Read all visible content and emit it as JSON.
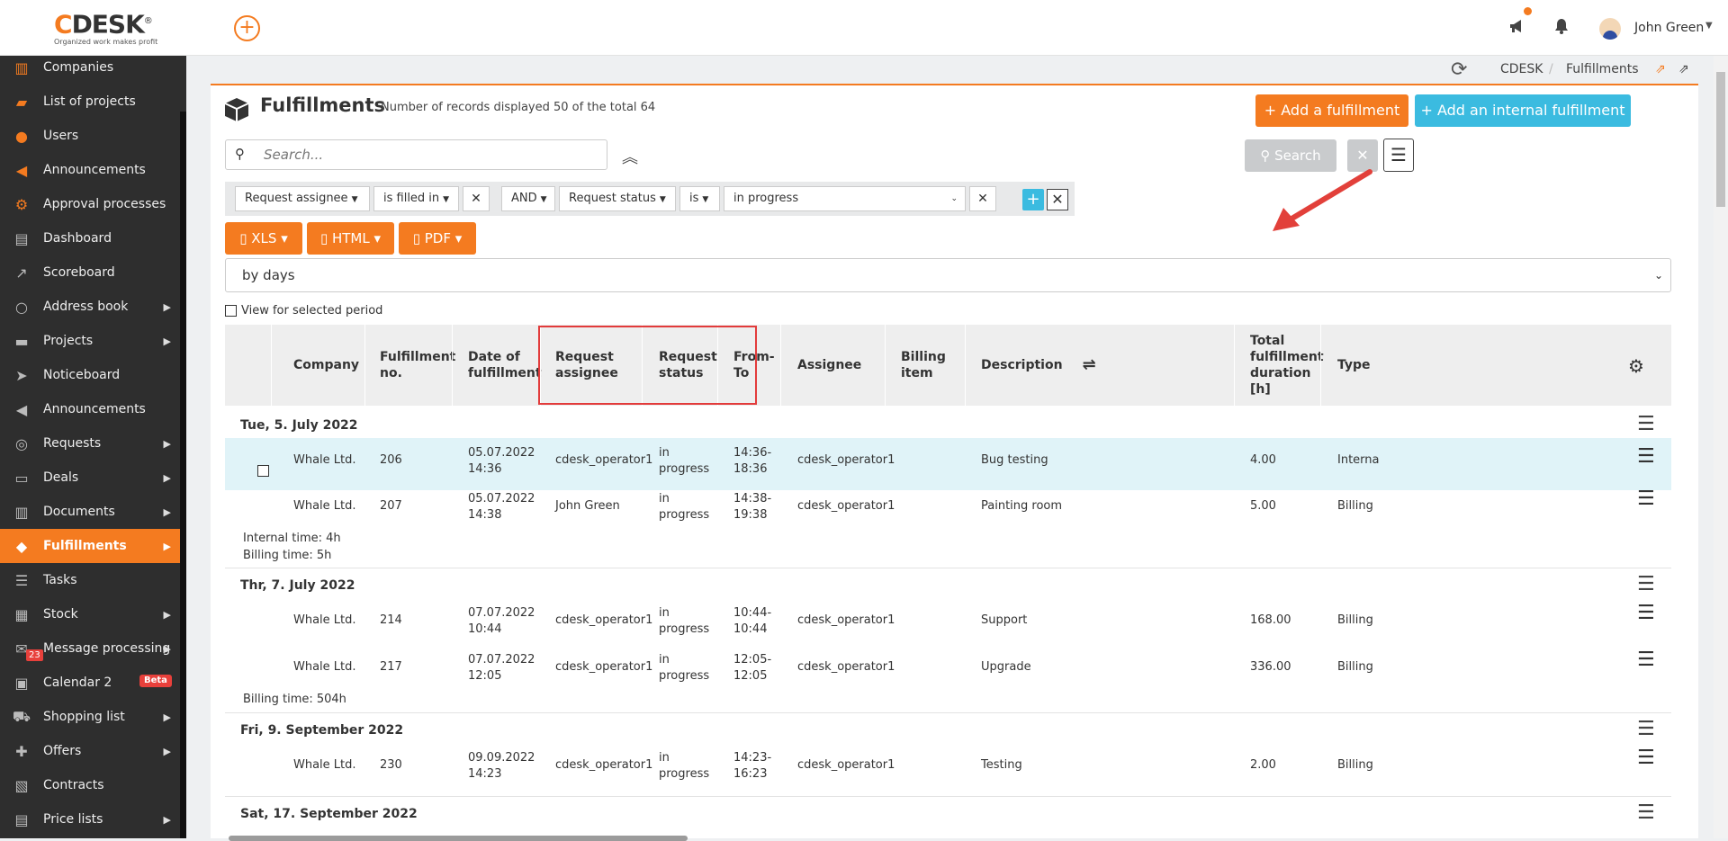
{
  "header": {
    "logo_brand_c": "C",
    "logo_brand_rest": "DESK",
    "logo_reg": "®",
    "logo_tagline": "Organized work makes profit",
    "add_symbol": "+",
    "user_name": "John Green"
  },
  "sidebar": {
    "items": [
      {
        "label": "Companies"
      },
      {
        "label": "List of projects"
      },
      {
        "label": "Users"
      },
      {
        "label": "Announcements"
      },
      {
        "label": "Approval processes"
      },
      {
        "label": "Dashboard"
      },
      {
        "label": "Scoreboard"
      },
      {
        "label": "Address book"
      },
      {
        "label": "Projects"
      },
      {
        "label": "Noticeboard"
      },
      {
        "label": "Announcements"
      },
      {
        "label": "Requests"
      },
      {
        "label": "Deals"
      },
      {
        "label": "Documents"
      },
      {
        "label": "Fulfillments"
      },
      {
        "label": "Tasks"
      },
      {
        "label": "Stock"
      },
      {
        "label": "Message processing",
        "badge": "23"
      },
      {
        "label": "Calendar 2",
        "tag": "Beta"
      },
      {
        "label": "Shopping list"
      },
      {
        "label": "Offers"
      },
      {
        "label": "Contracts"
      },
      {
        "label": "Price lists"
      }
    ]
  },
  "breadcrumb": {
    "items": [
      "CDESK",
      "Fulfillments"
    ]
  },
  "page": {
    "title": "Fulfillments",
    "subtitle": "Number of records displayed 50 of the total 64",
    "add_fulfillment": "+ Add a fulfillment",
    "add_internal": "+ Add an internal fulfillment"
  },
  "search": {
    "placeholder": "Search...",
    "button": "Search"
  },
  "filters": {
    "f1_field": "Request assignee",
    "f1_op": "is filled in",
    "join": "AND",
    "f2_field": "Request status",
    "f2_op": "is",
    "f2_value": "in progress"
  },
  "exports": {
    "xls": "XLS",
    "html": "HTML",
    "pdf": "PDF"
  },
  "period": {
    "value": "by days"
  },
  "view_selected_period": "View for selected period",
  "table": {
    "headers": {
      "company": "Company",
      "fno_1": "Fulfillment",
      "fno_2": "no.",
      "date_1": "Date of",
      "date_2": "fulfillment",
      "rassign_1": "Request",
      "rassign_2": "assignee",
      "rstatus_1": "Request",
      "rstatus_2": "status",
      "fromto_1": "From-",
      "fromto_2": "To",
      "assignee": "Assignee",
      "billing_1": "Billing",
      "billing_2": "item",
      "description": "Description",
      "total_1": "Total",
      "total_2": "fulfillment",
      "total_3": "duration",
      "total_4": "[h]",
      "type": "Type"
    },
    "groups": [
      {
        "date": "Tue, 5. July 2022",
        "rows": [
          {
            "company": "Whale Ltd.",
            "no": "206",
            "date1": "05.07.2022",
            "date2": "14:36",
            "rassignee": "cdesk_operator1",
            "status1": "in",
            "status2": "progress",
            "ft1": "14:36-",
            "ft2": "18:36",
            "assignee": "cdesk_operator1",
            "billing": "",
            "description": "Bug testing",
            "total": "4.00",
            "type": "Interna"
          },
          {
            "company": "Whale Ltd.",
            "no": "207",
            "date1": "05.07.2022",
            "date2": "14:38",
            "rassignee": "John Green",
            "status1": "in",
            "status2": "progress",
            "ft1": "14:38-",
            "ft2": "19:38",
            "assignee": "cdesk_operator1",
            "billing": "",
            "description": "Painting room",
            "total": "5.00",
            "type": "Billing"
          }
        ],
        "summary": [
          "Internal time: 4h",
          "Billing time: 5h"
        ]
      },
      {
        "date": "Thr, 7. July 2022",
        "rows": [
          {
            "company": "Whale Ltd.",
            "no": "214",
            "date1": "07.07.2022",
            "date2": "10:44",
            "rassignee": "cdesk_operator1",
            "status1": "in",
            "status2": "progress",
            "ft1": "10:44-",
            "ft2": "10:44",
            "assignee": "cdesk_operator1",
            "billing": "",
            "description": "Support",
            "total": "168.00",
            "type": "Billing"
          },
          {
            "company": "Whale Ltd.",
            "no": "217",
            "date1": "07.07.2022",
            "date2": "12:05",
            "rassignee": "cdesk_operator1",
            "status1": "in",
            "status2": "progress",
            "ft1": "12:05-",
            "ft2": "12:05",
            "assignee": "cdesk_operator1",
            "billing": "",
            "description": "Upgrade",
            "total": "336.00",
            "type": "Billing"
          }
        ],
        "summary": [
          "Billing time: 504h"
        ]
      },
      {
        "date": "Fri, 9. September 2022",
        "rows": [
          {
            "company": "Whale Ltd.",
            "no": "230",
            "date1": "09.09.2022",
            "date2": "14:23",
            "rassignee": "cdesk_operator1",
            "status1": "in",
            "status2": "progress",
            "ft1": "14:23-",
            "ft2": "16:23",
            "assignee": "cdesk_operator1",
            "billing": "",
            "description": "Testing",
            "total": "2.00",
            "type": "Billing"
          }
        ],
        "summary": []
      },
      {
        "date": "Sat, 17. September 2022",
        "rows": [],
        "summary": []
      }
    ]
  },
  "colors": {
    "accent": "#f47b20",
    "info": "#3bbbe0",
    "sidebar": "#2e2e2e",
    "highlight": "#e23b3b"
  }
}
